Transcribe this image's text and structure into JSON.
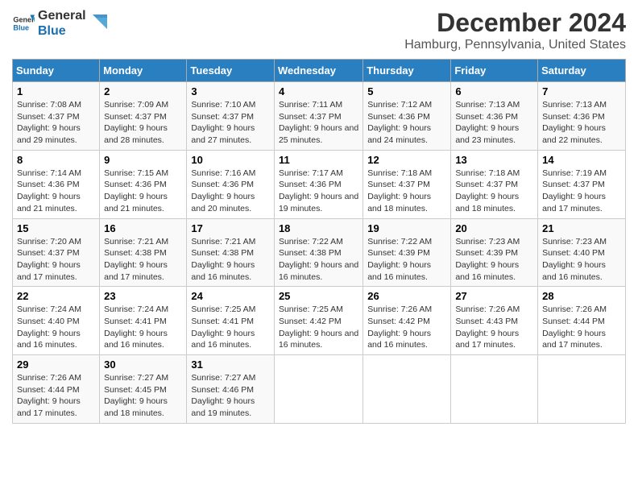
{
  "logo": {
    "text_general": "General",
    "text_blue": "Blue"
  },
  "header": {
    "title": "December 2024",
    "subtitle": "Hamburg, Pennsylvania, United States"
  },
  "days_of_week": [
    "Sunday",
    "Monday",
    "Tuesday",
    "Wednesday",
    "Thursday",
    "Friday",
    "Saturday"
  ],
  "weeks": [
    [
      {
        "day": "1",
        "sunrise": "7:08 AM",
        "sunset": "4:37 PM",
        "daylight": "9 hours and 29 minutes."
      },
      {
        "day": "2",
        "sunrise": "7:09 AM",
        "sunset": "4:37 PM",
        "daylight": "9 hours and 28 minutes."
      },
      {
        "day": "3",
        "sunrise": "7:10 AM",
        "sunset": "4:37 PM",
        "daylight": "9 hours and 27 minutes."
      },
      {
        "day": "4",
        "sunrise": "7:11 AM",
        "sunset": "4:37 PM",
        "daylight": "9 hours and 25 minutes."
      },
      {
        "day": "5",
        "sunrise": "7:12 AM",
        "sunset": "4:36 PM",
        "daylight": "9 hours and 24 minutes."
      },
      {
        "day": "6",
        "sunrise": "7:13 AM",
        "sunset": "4:36 PM",
        "daylight": "9 hours and 23 minutes."
      },
      {
        "day": "7",
        "sunrise": "7:13 AM",
        "sunset": "4:36 PM",
        "daylight": "9 hours and 22 minutes."
      }
    ],
    [
      {
        "day": "8",
        "sunrise": "7:14 AM",
        "sunset": "4:36 PM",
        "daylight": "9 hours and 21 minutes."
      },
      {
        "day": "9",
        "sunrise": "7:15 AM",
        "sunset": "4:36 PM",
        "daylight": "9 hours and 21 minutes."
      },
      {
        "day": "10",
        "sunrise": "7:16 AM",
        "sunset": "4:36 PM",
        "daylight": "9 hours and 20 minutes."
      },
      {
        "day": "11",
        "sunrise": "7:17 AM",
        "sunset": "4:36 PM",
        "daylight": "9 hours and 19 minutes."
      },
      {
        "day": "12",
        "sunrise": "7:18 AM",
        "sunset": "4:37 PM",
        "daylight": "9 hours and 18 minutes."
      },
      {
        "day": "13",
        "sunrise": "7:18 AM",
        "sunset": "4:37 PM",
        "daylight": "9 hours and 18 minutes."
      },
      {
        "day": "14",
        "sunrise": "7:19 AM",
        "sunset": "4:37 PM",
        "daylight": "9 hours and 17 minutes."
      }
    ],
    [
      {
        "day": "15",
        "sunrise": "7:20 AM",
        "sunset": "4:37 PM",
        "daylight": "9 hours and 17 minutes."
      },
      {
        "day": "16",
        "sunrise": "7:21 AM",
        "sunset": "4:38 PM",
        "daylight": "9 hours and 17 minutes."
      },
      {
        "day": "17",
        "sunrise": "7:21 AM",
        "sunset": "4:38 PM",
        "daylight": "9 hours and 16 minutes."
      },
      {
        "day": "18",
        "sunrise": "7:22 AM",
        "sunset": "4:38 PM",
        "daylight": "9 hours and 16 minutes."
      },
      {
        "day": "19",
        "sunrise": "7:22 AM",
        "sunset": "4:39 PM",
        "daylight": "9 hours and 16 minutes."
      },
      {
        "day": "20",
        "sunrise": "7:23 AM",
        "sunset": "4:39 PM",
        "daylight": "9 hours and 16 minutes."
      },
      {
        "day": "21",
        "sunrise": "7:23 AM",
        "sunset": "4:40 PM",
        "daylight": "9 hours and 16 minutes."
      }
    ],
    [
      {
        "day": "22",
        "sunrise": "7:24 AM",
        "sunset": "4:40 PM",
        "daylight": "9 hours and 16 minutes."
      },
      {
        "day": "23",
        "sunrise": "7:24 AM",
        "sunset": "4:41 PM",
        "daylight": "9 hours and 16 minutes."
      },
      {
        "day": "24",
        "sunrise": "7:25 AM",
        "sunset": "4:41 PM",
        "daylight": "9 hours and 16 minutes."
      },
      {
        "day": "25",
        "sunrise": "7:25 AM",
        "sunset": "4:42 PM",
        "daylight": "9 hours and 16 minutes."
      },
      {
        "day": "26",
        "sunrise": "7:26 AM",
        "sunset": "4:42 PM",
        "daylight": "9 hours and 16 minutes."
      },
      {
        "day": "27",
        "sunrise": "7:26 AM",
        "sunset": "4:43 PM",
        "daylight": "9 hours and 17 minutes."
      },
      {
        "day": "28",
        "sunrise": "7:26 AM",
        "sunset": "4:44 PM",
        "daylight": "9 hours and 17 minutes."
      }
    ],
    [
      {
        "day": "29",
        "sunrise": "7:26 AM",
        "sunset": "4:44 PM",
        "daylight": "9 hours and 17 minutes."
      },
      {
        "day": "30",
        "sunrise": "7:27 AM",
        "sunset": "4:45 PM",
        "daylight": "9 hours and 18 minutes."
      },
      {
        "day": "31",
        "sunrise": "7:27 AM",
        "sunset": "4:46 PM",
        "daylight": "9 hours and 19 minutes."
      },
      null,
      null,
      null,
      null
    ]
  ],
  "labels": {
    "sunrise": "Sunrise:",
    "sunset": "Sunset:",
    "daylight": "Daylight:"
  }
}
